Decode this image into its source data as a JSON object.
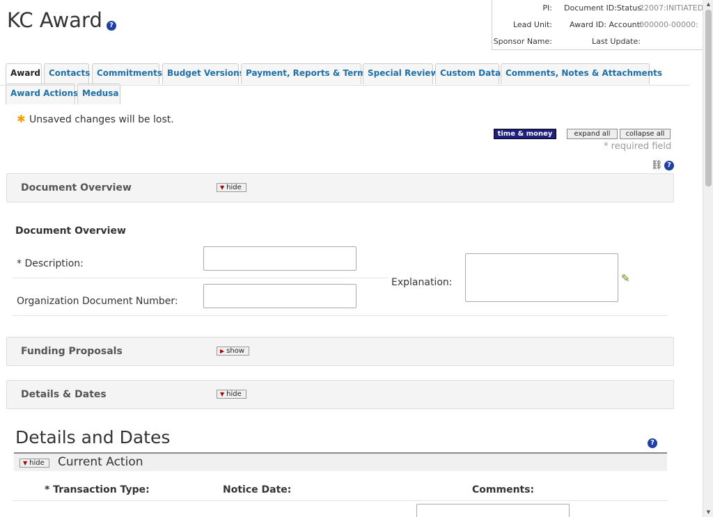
{
  "header": {
    "title": "KC Award",
    "info": {
      "pi_label": "PI:",
      "doc_id_label": "Document ID:Status:",
      "doc_id_value": "22007:INITIATED",
      "lead_unit_label": "Lead Unit:",
      "award_id_label": "Award ID: Account:",
      "award_id_value": "000000-00000:",
      "sponsor_label": "Sponsor Name:",
      "last_update_label": "Last Update:"
    }
  },
  "tabs": [
    "Award",
    "Contacts",
    "Commitments",
    "Budget Versions",
    "Payment, Reports & Terms",
    "Special Review",
    "Custom Data",
    "Comments, Notes & Attachments",
    "Award Actions",
    "Medusa"
  ],
  "messages": {
    "unsaved": "Unsaved changes will be lost."
  },
  "toolbar": {
    "time_money": "time & money",
    "expand_all": "expand all",
    "collapse_all": "collapse all",
    "required_note": "* required field"
  },
  "sections": {
    "document_overview": {
      "title": "Document Overview",
      "toggle": "hide"
    },
    "funding_proposals": {
      "title": "Funding Proposals",
      "toggle": "show"
    },
    "details_dates": {
      "title": "Details & Dates",
      "toggle": "hide"
    }
  },
  "document_overview": {
    "heading": "Document Overview",
    "description_label": "*  Description:",
    "org_doc_label": "Organization Document Number:",
    "explanation_label": "Explanation:",
    "description_value": "",
    "org_doc_value": "",
    "explanation_value": ""
  },
  "details_and_dates": {
    "title": "Details and Dates",
    "current_action": {
      "toggle": "hide",
      "title": "Current Action"
    },
    "columns": {
      "transaction_type": "*  Transaction Type:",
      "notice_date": "Notice Date:",
      "comments": "Comments:"
    }
  },
  "icons": {
    "help": "help-icon",
    "link": "link-icon",
    "asterisk": "asterisk-icon",
    "pencil": "pencil-icon"
  },
  "colors": {
    "accent_blue": "#1e3fa6",
    "tab_link": "#1f6fa8",
    "time_money_bg": "#1f1f80",
    "warning_orange": "#f5a000"
  }
}
